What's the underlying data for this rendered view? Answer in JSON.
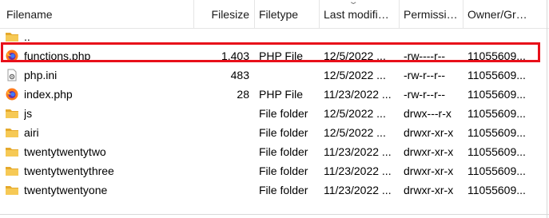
{
  "columns": {
    "filename": "Filename",
    "filesize": "Filesize",
    "filetype": "Filetype",
    "modified": "Last modifi…",
    "permissions": "Permissi…",
    "owner": "Owner/Gr…"
  },
  "rows": [
    {
      "name": "..",
      "size": "",
      "type": "",
      "modified": "",
      "permissions": "",
      "owner": "",
      "icon": "folder-icon"
    },
    {
      "name": "functions.php",
      "size": "1.403",
      "type": "PHP File",
      "modified": "12/5/2022 ...",
      "permissions": "-rw----r--",
      "owner": "11055609...",
      "icon": "firefox-icon"
    },
    {
      "name": "php.ini",
      "size": "483",
      "type": "",
      "modified": "12/5/2022 ...",
      "permissions": "-rw-r--r--",
      "owner": "11055609...",
      "icon": "ini-file-icon"
    },
    {
      "name": "index.php",
      "size": "28",
      "type": "PHP File",
      "modified": "11/23/2022 ...",
      "permissions": "-rw-r--r--",
      "owner": "11055609...",
      "icon": "firefox-icon"
    },
    {
      "name": "js",
      "size": "",
      "type": "File folder",
      "modified": "12/5/2022 ...",
      "permissions": "drwx---r-x",
      "owner": "11055609...",
      "icon": "folder-icon"
    },
    {
      "name": "airi",
      "size": "",
      "type": "File folder",
      "modified": "12/5/2022 ...",
      "permissions": "drwxr-xr-x",
      "owner": "11055609...",
      "icon": "folder-icon"
    },
    {
      "name": "twentytwentytwo",
      "size": "",
      "type": "File folder",
      "modified": "11/23/2022 ...",
      "permissions": "drwxr-xr-x",
      "owner": "11055609...",
      "icon": "folder-icon"
    },
    {
      "name": "twentytwentythree",
      "size": "",
      "type": "File folder",
      "modified": "11/23/2022 ...",
      "permissions": "drwxr-xr-x",
      "owner": "11055609...",
      "icon": "folder-icon"
    },
    {
      "name": "twentytwentyone",
      "size": "",
      "type": "File folder",
      "modified": "11/23/2022 ...",
      "permissions": "drwxr-xr-x",
      "owner": "11055609...",
      "icon": "folder-icon"
    }
  ],
  "colors": {
    "highlight": "#e8101a",
    "folder": "#f3c04a"
  }
}
